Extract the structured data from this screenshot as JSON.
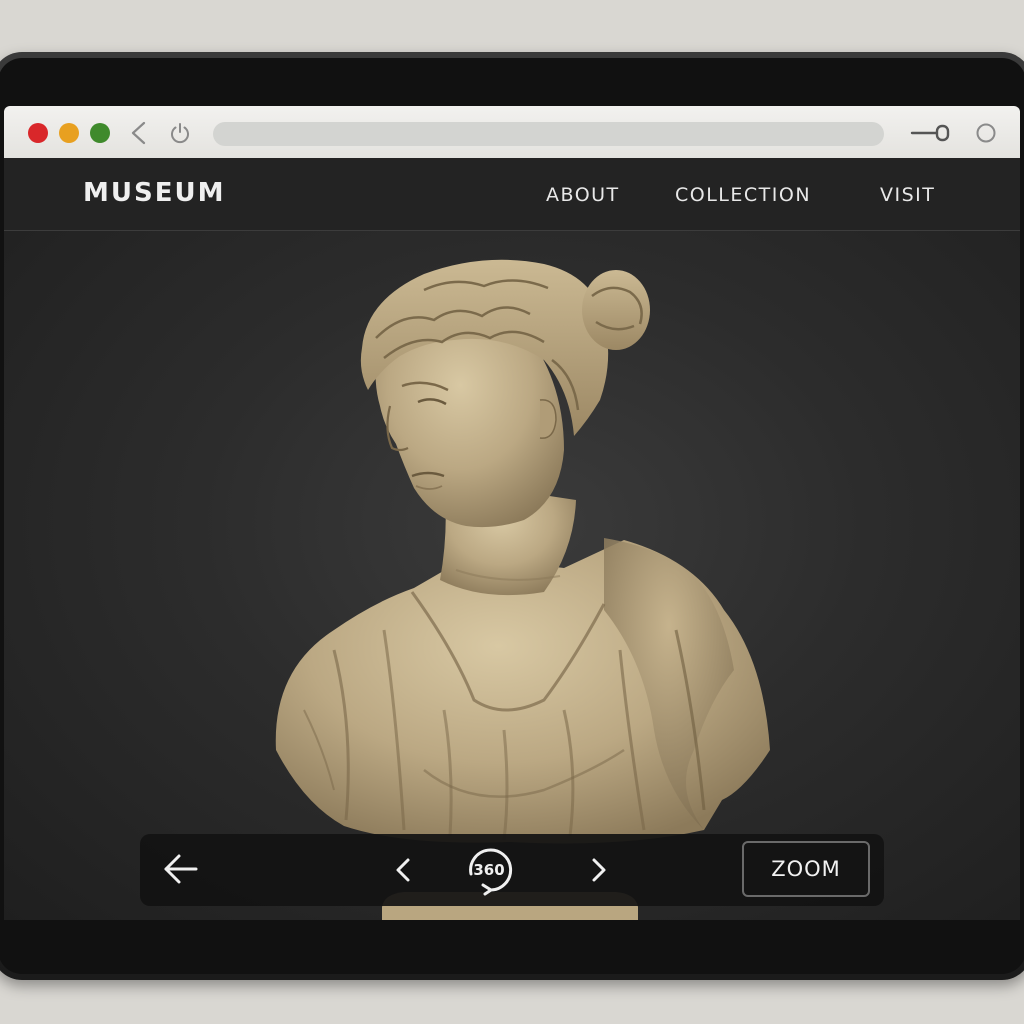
{
  "browser": {
    "address_value": "",
    "icons": [
      "back-arrow-icon",
      "power-icon",
      "key-icon",
      "circle-icon"
    ],
    "traffic_lights": {
      "close": "#d9272a",
      "minimize": "#e8a020",
      "maximize": "#3f8a2c"
    }
  },
  "nav": {
    "logo": "MUSEUM",
    "links": [
      {
        "label": "ABOUT"
      },
      {
        "label": "COLLECTION"
      },
      {
        "label": "VISIT"
      }
    ]
  },
  "viewer": {
    "image": "classical-marble-bust",
    "controls": {
      "back_icon": "arrow-left-icon",
      "prev_icon": "chevron-left-icon",
      "rotate_label": "360",
      "next_icon": "chevron-right-icon",
      "zoom_label": "ZOOM"
    }
  },
  "colors": {
    "page_background": "#2a2a2a",
    "nav_background": "#232323",
    "marble": "#c2b08c",
    "control_bar": "#121212"
  }
}
